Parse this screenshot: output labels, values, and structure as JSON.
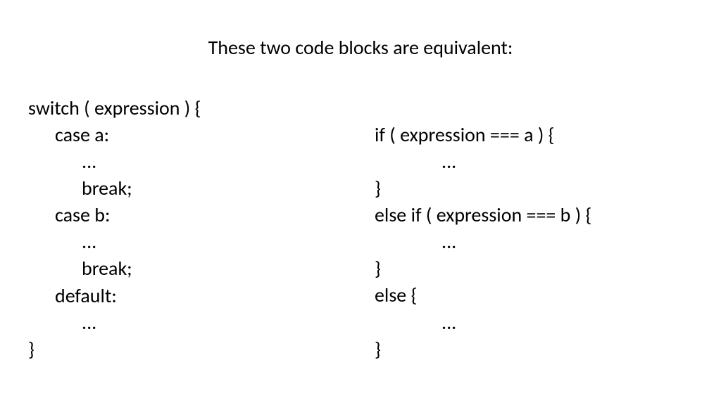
{
  "title": "These two code blocks are equivalent:",
  "left": {
    "l0": "switch ( expression ) {",
    "l1": "case a:",
    "l2": "...",
    "l3": "break;",
    "l4": "case b:",
    "l5": "...",
    "l6": "break;",
    "l7": "default:",
    "l8": "...",
    "l9": "}"
  },
  "right": {
    "l0": "if ( expression === a ) {",
    "l1": "...",
    "l2": "}",
    "l3": "else if ( expression === b ) {",
    "l4": "...",
    "l5": "}",
    "l6": "else {",
    "l7": "...",
    "l8": "}"
  }
}
